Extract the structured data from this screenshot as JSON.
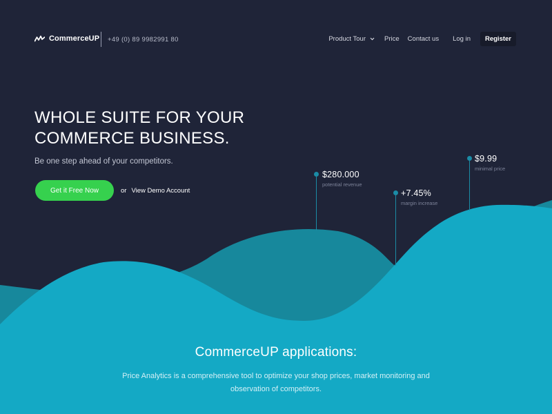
{
  "header": {
    "logo_text": "CommerceUP",
    "logo_icon": "pulse-icon",
    "phone": "+49 (0) 89 9982991 80",
    "nav": {
      "product_tour": "Product Tour",
      "price": "Price",
      "contact": "Contact us",
      "login": "Log in",
      "register": "Register"
    }
  },
  "hero": {
    "title_line1": "WHOLE SUITE FOR YOUR",
    "title_line2": "COMMERCE BUSINESS.",
    "subtitle": "Be one step ahead of your competitors.",
    "cta_label": "Get it Free Now",
    "or_text": "or",
    "demo_link": "View Demo Account"
  },
  "stats": [
    {
      "value": "$280.000",
      "label": "potential revenue"
    },
    {
      "value": "+7.45%",
      "label": "margin increase"
    },
    {
      "value": "$9.99",
      "label": "minimal price"
    }
  ],
  "apps": {
    "title": "CommerceUP applications:",
    "description": "Price Analytics is a comprehensive tool to optimize your shop prices, market monitoring and observation of competitors."
  },
  "colors": {
    "background": "#1f2438",
    "cta": "#36d14e",
    "wave_back": "#17889c",
    "wave_front": "#14a9c5",
    "accent": "#1b8ca6"
  }
}
